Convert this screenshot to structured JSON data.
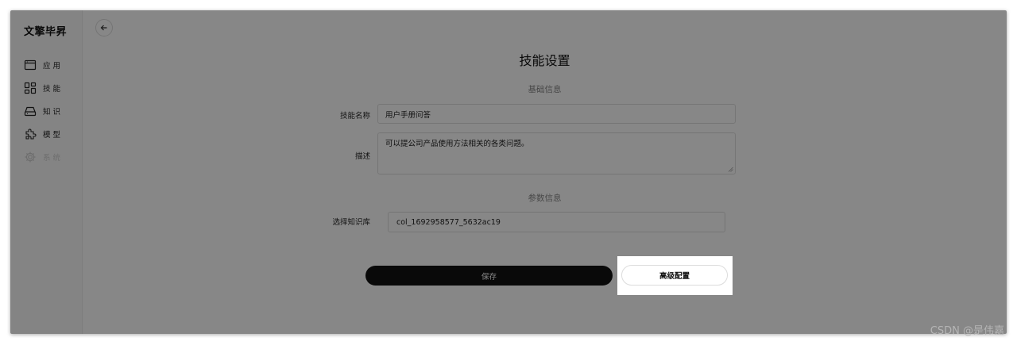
{
  "sidebar": {
    "brand": "文擎毕昇",
    "items": [
      {
        "label": "应用",
        "icon": "window-icon"
      },
      {
        "label": "技能",
        "icon": "grid-icon"
      },
      {
        "label": "知识",
        "icon": "drive-icon"
      },
      {
        "label": "模型",
        "icon": "puzzle-icon"
      },
      {
        "label": "系统",
        "icon": "gear-icon",
        "disabled": true
      }
    ]
  },
  "page": {
    "title": "技能设置",
    "basic_section": "基础信息",
    "param_section": "参数信息"
  },
  "form": {
    "skill_name_label": "技能名称",
    "skill_name_value": "用户手册问答",
    "description_label": "描述",
    "description_value": "可以提公司产品使用方法相关的各类问题。",
    "knowledge_label": "选择知识库",
    "knowledge_value": "col_1692958577_5632ac19"
  },
  "actions": {
    "save_label": "保存",
    "advanced_label": "高级配置"
  },
  "watermark": "CSDN @是伟嘉",
  "colors": {
    "overlay": "rgba(0,0,0,0.47)",
    "primary_button": "#111111"
  }
}
